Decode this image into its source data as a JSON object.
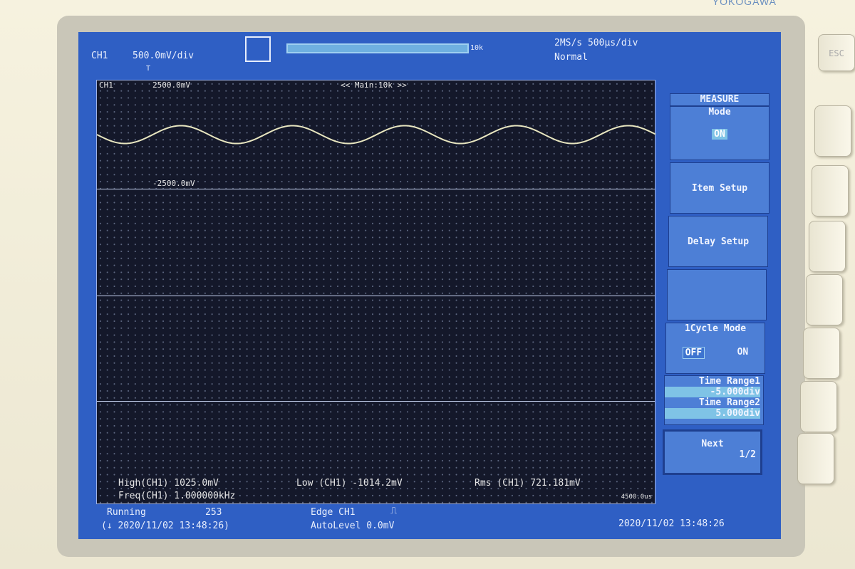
{
  "brand": "YOKOGAWA",
  "header": {
    "channel": "CH1",
    "vdiv": "500.0mV/div",
    "record_length": "10k",
    "sample_rate": "2MS/s 500µs/div",
    "trigger_mode": "Normal"
  },
  "graticule": {
    "channel_label": "CH1",
    "upper_level": "2500.0mV",
    "lower_level": "-2500.0mV",
    "zoom_label": "<< Main:10k >>",
    "time_end": "4500.0us"
  },
  "measure": {
    "high": "High(CH1)  1025.0mV",
    "low": "Low (CH1) -1014.2mV",
    "rms": "Rms (CH1)  721.181mV",
    "freq": "Freq(CH1)  1.000000kHz"
  },
  "status": {
    "state": "Running",
    "count": "253",
    "timestamp_acq": "(↓ 2020/11/02 13:48:26)",
    "trigger": "Edge CH1",
    "trigger_level": "AutoLevel 0.0mV",
    "clock": "2020/11/02 13:48:26"
  },
  "menu": {
    "title": "MEASURE",
    "mode_label": "Mode",
    "mode_value": "ON",
    "item_setup": "Item Setup",
    "delay_setup": "Delay Setup",
    "cycle_label": "1Cycle Mode",
    "cycle_off": "OFF",
    "cycle_on": "ON",
    "range1_label": "Time Range1",
    "range1_value": "-5.000div",
    "range2_label": "Time Range2",
    "range2_value": "5.000div",
    "next_label": "Next",
    "page": "1/2"
  },
  "keys": {
    "esc": "ESC"
  },
  "waveform": {
    "frequency_khz": 1.0,
    "cycles_shown": 5,
    "amplitude_mv": 1020,
    "color": "#e8e6c0"
  }
}
